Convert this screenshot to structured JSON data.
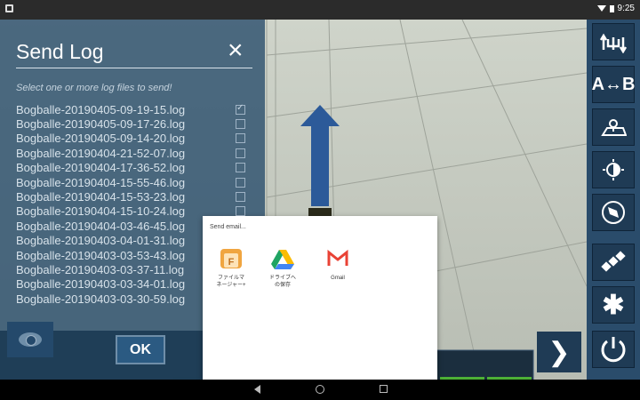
{
  "status_bar": {
    "time": "9:25"
  },
  "send_log_panel": {
    "title": "Send Log",
    "close_symbol": "×",
    "subtitle": "Select one or more log files to send!",
    "ok_label": "OK",
    "log_files": [
      {
        "name": "Bogballe-20190405-09-19-15.log",
        "checked": true
      },
      {
        "name": "Bogballe-20190405-09-17-26.log",
        "checked": false
      },
      {
        "name": "Bogballe-20190405-09-14-20.log",
        "checked": false
      },
      {
        "name": "Bogballe-20190404-21-52-07.log",
        "checked": false
      },
      {
        "name": "Bogballe-20190404-17-36-52.log",
        "checked": false
      },
      {
        "name": "Bogballe-20190404-15-55-46.log",
        "checked": false
      },
      {
        "name": "Bogballe-20190404-15-53-23.log",
        "checked": false
      },
      {
        "name": "Bogballe-20190404-15-10-24.log",
        "checked": false
      },
      {
        "name": "Bogballe-20190404-03-46-45.log",
        "checked": false
      },
      {
        "name": "Bogballe-20190403-04-01-31.log",
        "checked": false
      },
      {
        "name": "Bogballe-20190403-03-53-43.log",
        "checked": false
      },
      {
        "name": "Bogballe-20190403-03-37-11.log",
        "checked": false
      },
      {
        "name": "Bogballe-20190403-03-34-01.log",
        "checked": false
      },
      {
        "name": "Bogballe-20190403-03-30-59.log",
        "checked": false
      }
    ]
  },
  "toolbar": {
    "buttons": [
      {
        "name": "boom-width-icon",
        "label": ""
      },
      {
        "name": "a-b-line-icon",
        "label": "A↔B"
      },
      {
        "name": "field-map-icon",
        "label": ""
      },
      {
        "name": "brightness-icon",
        "label": ""
      },
      {
        "name": "compass-icon",
        "label": ""
      },
      {
        "name": "satellite-icon",
        "label": ""
      },
      {
        "name": "settings-icon",
        "label": ""
      },
      {
        "name": "power-icon",
        "label": ""
      }
    ]
  },
  "share_dialog": {
    "title": "Send email...",
    "apps": [
      {
        "label_line1": "ファイルマ",
        "label_line2": "ネージャー+"
      },
      {
        "label_line1": "ドライブへ",
        "label_line2": "の保存"
      },
      {
        "label_line1": "Gmail",
        "label_line2": ""
      }
    ]
  },
  "colors": {
    "panel_bg": "#2d506e",
    "toolbar_bg": "#2a4c6b",
    "dialog_bg": "#ffffff"
  }
}
